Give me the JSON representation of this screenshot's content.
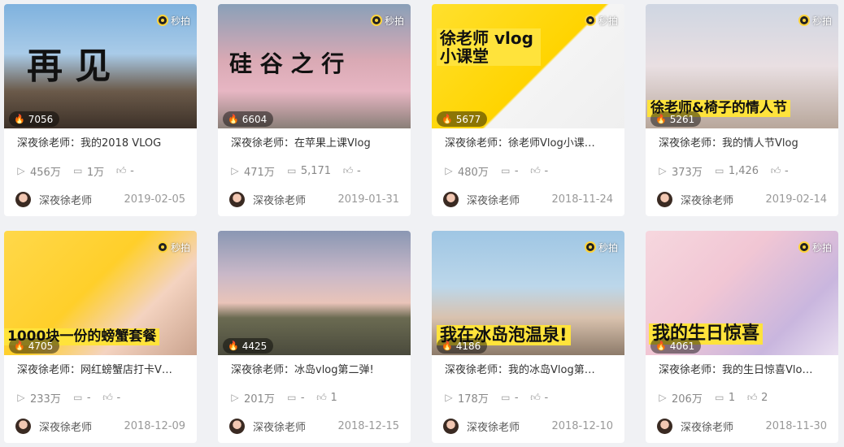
{
  "badge_label": "秒拍",
  "colors": {
    "page_bg": "#f0f1f4",
    "card_bg": "#ffffff",
    "like_fire": "#ff4f6a"
  },
  "cards": [
    {
      "likes": "7056",
      "title": "深夜徐老师：我的2018 VLOG",
      "views": "456万",
      "comments": "1万",
      "thumbs": "-",
      "author": "深夜徐老师",
      "date": "2019-02-05",
      "overlay": "再  见",
      "bg": "linear-gradient(180deg,#7fb2de 0%,#a9cbe8 40%,#6b5a4a 70%,#3d3128 100%)"
    },
    {
      "likes": "6604",
      "title": "深夜徐老师：在苹果上课Vlog",
      "views": "471万",
      "comments": "5,171",
      "thumbs": "-",
      "author": "深夜徐老师",
      "date": "2019-01-31",
      "overlay": "硅 谷 之 行",
      "bg": "linear-gradient(180deg,#8aa0b8 0%,#d9a9b4 45%,#e7b6c3 70%,#8a7f78 100%)"
    },
    {
      "likes": "5677",
      "title": "深夜徐老师：徐老师Vlog小课…",
      "views": "480万",
      "comments": "-",
      "thumbs": "-",
      "author": "深夜徐老师",
      "date": "2018-11-24",
      "overlay": "徐老师 vlog小课堂",
      "bg": "linear-gradient(135deg,#ffe02e 0%,#ffd400 55%,#f4f4f4 56%,#efefef 100%)"
    },
    {
      "likes": "5261",
      "title": "深夜徐老师：我的情人节Vlog",
      "views": "373万",
      "comments": "1,426",
      "thumbs": "-",
      "author": "深夜徐老师",
      "date": "2019-02-14",
      "overlay": "徐老师&椅子的情人节",
      "bg": "linear-gradient(180deg,#cfd6e2 0%,#e9dfe2 50%,#b8a79b 100%)"
    },
    {
      "likes": "4705",
      "title": "深夜徐老师：网红螃蟹店打卡V…",
      "views": "233万",
      "comments": "-",
      "thumbs": "-",
      "author": "深夜徐老师",
      "date": "2018-12-09",
      "overlay": "1000块一份的螃蟹套餐",
      "bg": "linear-gradient(135deg,#ffd84a 0%,#ffcf2a 45%,#f4d3c0 70%,#caa38e 100%)"
    },
    {
      "likes": "4425",
      "title": "深夜徐老师：冰岛vlog第二弹!",
      "views": "201万",
      "comments": "-",
      "thumbs": "1",
      "author": "深夜徐老师",
      "date": "2018-12-15",
      "overlay": "",
      "bg": "linear-gradient(180deg,#8a97b3 0%,#c9b8c8 35%,#e9c4b9 58%,#6b6b52 70%,#4a4a3c 100%)"
    },
    {
      "likes": "4186",
      "title": "深夜徐老师：我的冰岛Vlog第…",
      "views": "178万",
      "comments": "-",
      "thumbs": "-",
      "author": "深夜徐老师",
      "date": "2018-12-10",
      "overlay": "我在冰岛泡温泉!",
      "bg": "linear-gradient(180deg,#9fc6e4 0%,#bcd7ea 45%,#d9c2ae 70%,#8d7b6a 100%)"
    },
    {
      "likes": "4061",
      "title": "深夜徐老师：我的生日惊喜Vlo…",
      "views": "206万",
      "comments": "1",
      "thumbs": "2",
      "author": "深夜徐老师",
      "date": "2018-11-30",
      "overlay": "我的生日惊喜",
      "bg": "linear-gradient(135deg,#f6d7de 0%,#f1c6d4 40%,#c9b6de 75%,#e9dff0 100%)"
    }
  ]
}
